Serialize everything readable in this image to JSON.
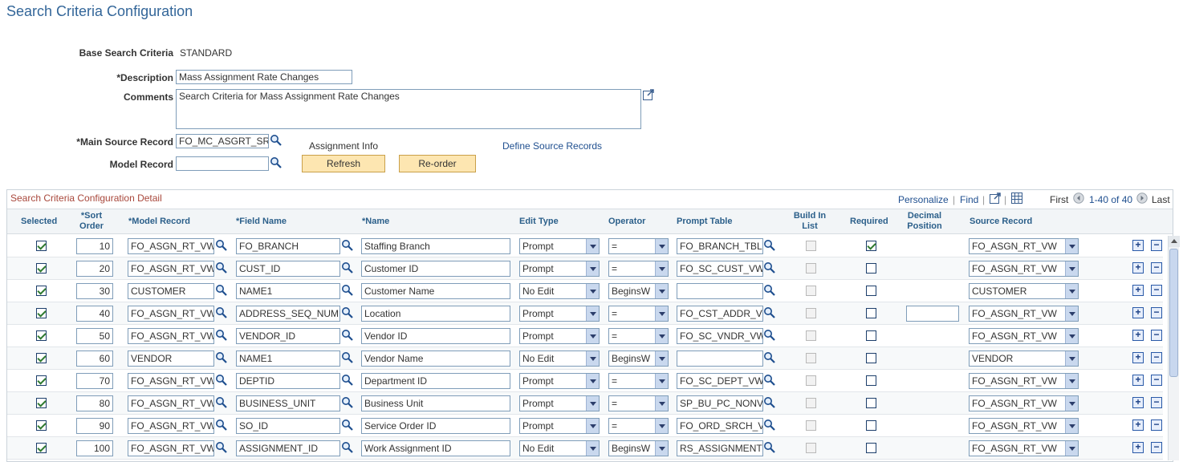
{
  "page": {
    "title": "Search Criteria Configuration"
  },
  "form": {
    "base_search_label": "Base Search Criteria",
    "base_search_value": "STANDARD",
    "description_label": "*Description",
    "description_value": "Mass Assignment Rate Changes",
    "comments_label": "Comments",
    "comments_value": "Search Criteria for Mass Assignment Rate Changes",
    "main_source_label": "*Main Source Record",
    "main_source_value": "FO_MC_ASGRT_SR",
    "model_record_label": "Model Record",
    "model_record_value": "",
    "assignment_info_label": "Assignment Info",
    "refresh_label": "Refresh",
    "reorder_label": "Re-order",
    "define_source_link": "Define Source Records"
  },
  "grid": {
    "title": "Search Criteria Configuration Detail",
    "personalize": "Personalize",
    "find": "Find",
    "first": "First",
    "range": "1-40 of 40",
    "last": "Last",
    "headers": {
      "selected": "Selected",
      "sort_order": "*Sort Order",
      "model_record": "*Model Record",
      "field_name": "*Field Name",
      "name": "*Name",
      "edit_type": "Edit Type",
      "operator": "Operator",
      "prompt_table": "Prompt Table",
      "build_in_list": "Build In List",
      "required": "Required",
      "decimal_position": "Decimal Position",
      "source_record": "Source Record"
    },
    "rows": [
      {
        "selected": true,
        "sort": "10",
        "model": "FO_ASGN_RT_VW",
        "field": "FO_BRANCH",
        "name": "Staffing Branch",
        "edit": "Prompt",
        "op": "=",
        "prompt": "FO_BRANCH_TBL",
        "build": false,
        "required": true,
        "decimal": null,
        "source": "FO_ASGN_RT_VW"
      },
      {
        "selected": true,
        "sort": "20",
        "model": "FO_ASGN_RT_VW",
        "field": "CUST_ID",
        "name": "Customer ID",
        "edit": "Prompt",
        "op": "=",
        "prompt": "FO_SC_CUST_VW",
        "build": false,
        "required": false,
        "decimal": null,
        "source": "FO_ASGN_RT_VW"
      },
      {
        "selected": true,
        "sort": "30",
        "model": "CUSTOMER",
        "field": "NAME1",
        "name": "Customer Name",
        "edit": "No Edit",
        "op": "BeginsW",
        "prompt": "",
        "build": false,
        "required": false,
        "decimal": null,
        "source": "CUSTOMER"
      },
      {
        "selected": true,
        "sort": "40",
        "model": "FO_ASGN_RT_VW",
        "field": "ADDRESS_SEQ_NUM",
        "name": "Location",
        "edit": "Prompt",
        "op": "=",
        "prompt": "FO_CST_ADDR_VW",
        "build": false,
        "required": false,
        "decimal": "",
        "source": "FO_ASGN_RT_VW"
      },
      {
        "selected": true,
        "sort": "50",
        "model": "FO_ASGN_RT_VW",
        "field": "VENDOR_ID",
        "name": "Vendor ID",
        "edit": "Prompt",
        "op": "=",
        "prompt": "FO_SC_VNDR_VW",
        "build": false,
        "required": false,
        "decimal": null,
        "source": "FO_ASGN_RT_VW"
      },
      {
        "selected": true,
        "sort": "60",
        "model": "VENDOR",
        "field": "NAME1",
        "name": "Vendor Name",
        "edit": "No Edit",
        "op": "BeginsW",
        "prompt": "",
        "build": false,
        "required": false,
        "decimal": null,
        "source": "VENDOR"
      },
      {
        "selected": true,
        "sort": "70",
        "model": "FO_ASGN_RT_VW",
        "field": "DEPTID",
        "name": "Department ID",
        "edit": "Prompt",
        "op": "=",
        "prompt": "FO_SC_DEPT_VW",
        "build": false,
        "required": false,
        "decimal": null,
        "source": "FO_ASGN_RT_VW"
      },
      {
        "selected": true,
        "sort": "80",
        "model": "FO_ASGN_RT_VW",
        "field": "BUSINESS_UNIT",
        "name": "Business Unit",
        "edit": "Prompt",
        "op": "=",
        "prompt": "SP_BU_PC_NONVW",
        "build": false,
        "required": false,
        "decimal": null,
        "source": "FO_ASGN_RT_VW"
      },
      {
        "selected": true,
        "sort": "90",
        "model": "FO_ASGN_RT_VW",
        "field": "SO_ID",
        "name": "Service Order ID",
        "edit": "Prompt",
        "op": "=",
        "prompt": "FO_ORD_SRCH_VW",
        "build": false,
        "required": false,
        "decimal": null,
        "source": "FO_ASGN_RT_VW"
      },
      {
        "selected": true,
        "sort": "100",
        "model": "FO_ASGN_RT_VW",
        "field": "ASSIGNMENT_ID",
        "name": "Work Assignment ID",
        "edit": "No Edit",
        "op": "BeginsW",
        "prompt": "RS_ASSIGNMENT",
        "build": false,
        "required": false,
        "decimal": null,
        "source": "FO_ASGN_RT_VW"
      }
    ]
  },
  "icons": {
    "lookup": "magnifier-icon",
    "add_row": "plus-icon",
    "delete_row": "minus-icon",
    "zoom": "new-window-icon",
    "download": "spreadsheet-icon"
  }
}
